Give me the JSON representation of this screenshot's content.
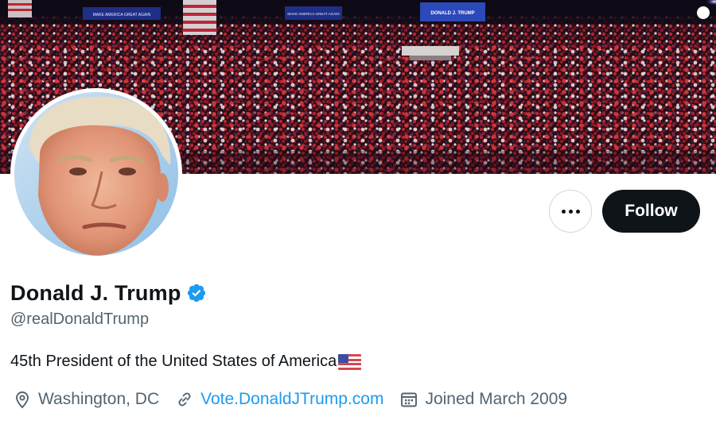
{
  "profile": {
    "display_name": "Donald J. Trump",
    "verified": true,
    "handle": "@realDonaldTrump",
    "bio": "45th President of the United States of America",
    "location": "Washington, DC",
    "website": "Vote.DonaldJTrump.com",
    "joined": "Joined March 2009"
  },
  "actions": {
    "more_icon": "more-horizontal-icon",
    "follow_label": "Follow"
  },
  "banner": {
    "signs": [
      "MAKE AMERICA GREAT AGAIN",
      "MAKE AMERICA GREAT AGAIN",
      "DONALD J. TRUMP"
    ]
  },
  "colors": {
    "follow_bg": "#0f1419",
    "verified": "#1d9bf0",
    "link": "#1d9bf0",
    "secondary_text": "#536471",
    "primary_text": "#0f1419"
  },
  "icons": {
    "verified": "verified-badge-icon",
    "flag": "us-flag-emoji",
    "location": "location-pin-icon",
    "link": "link-icon",
    "calendar": "calendar-icon"
  }
}
